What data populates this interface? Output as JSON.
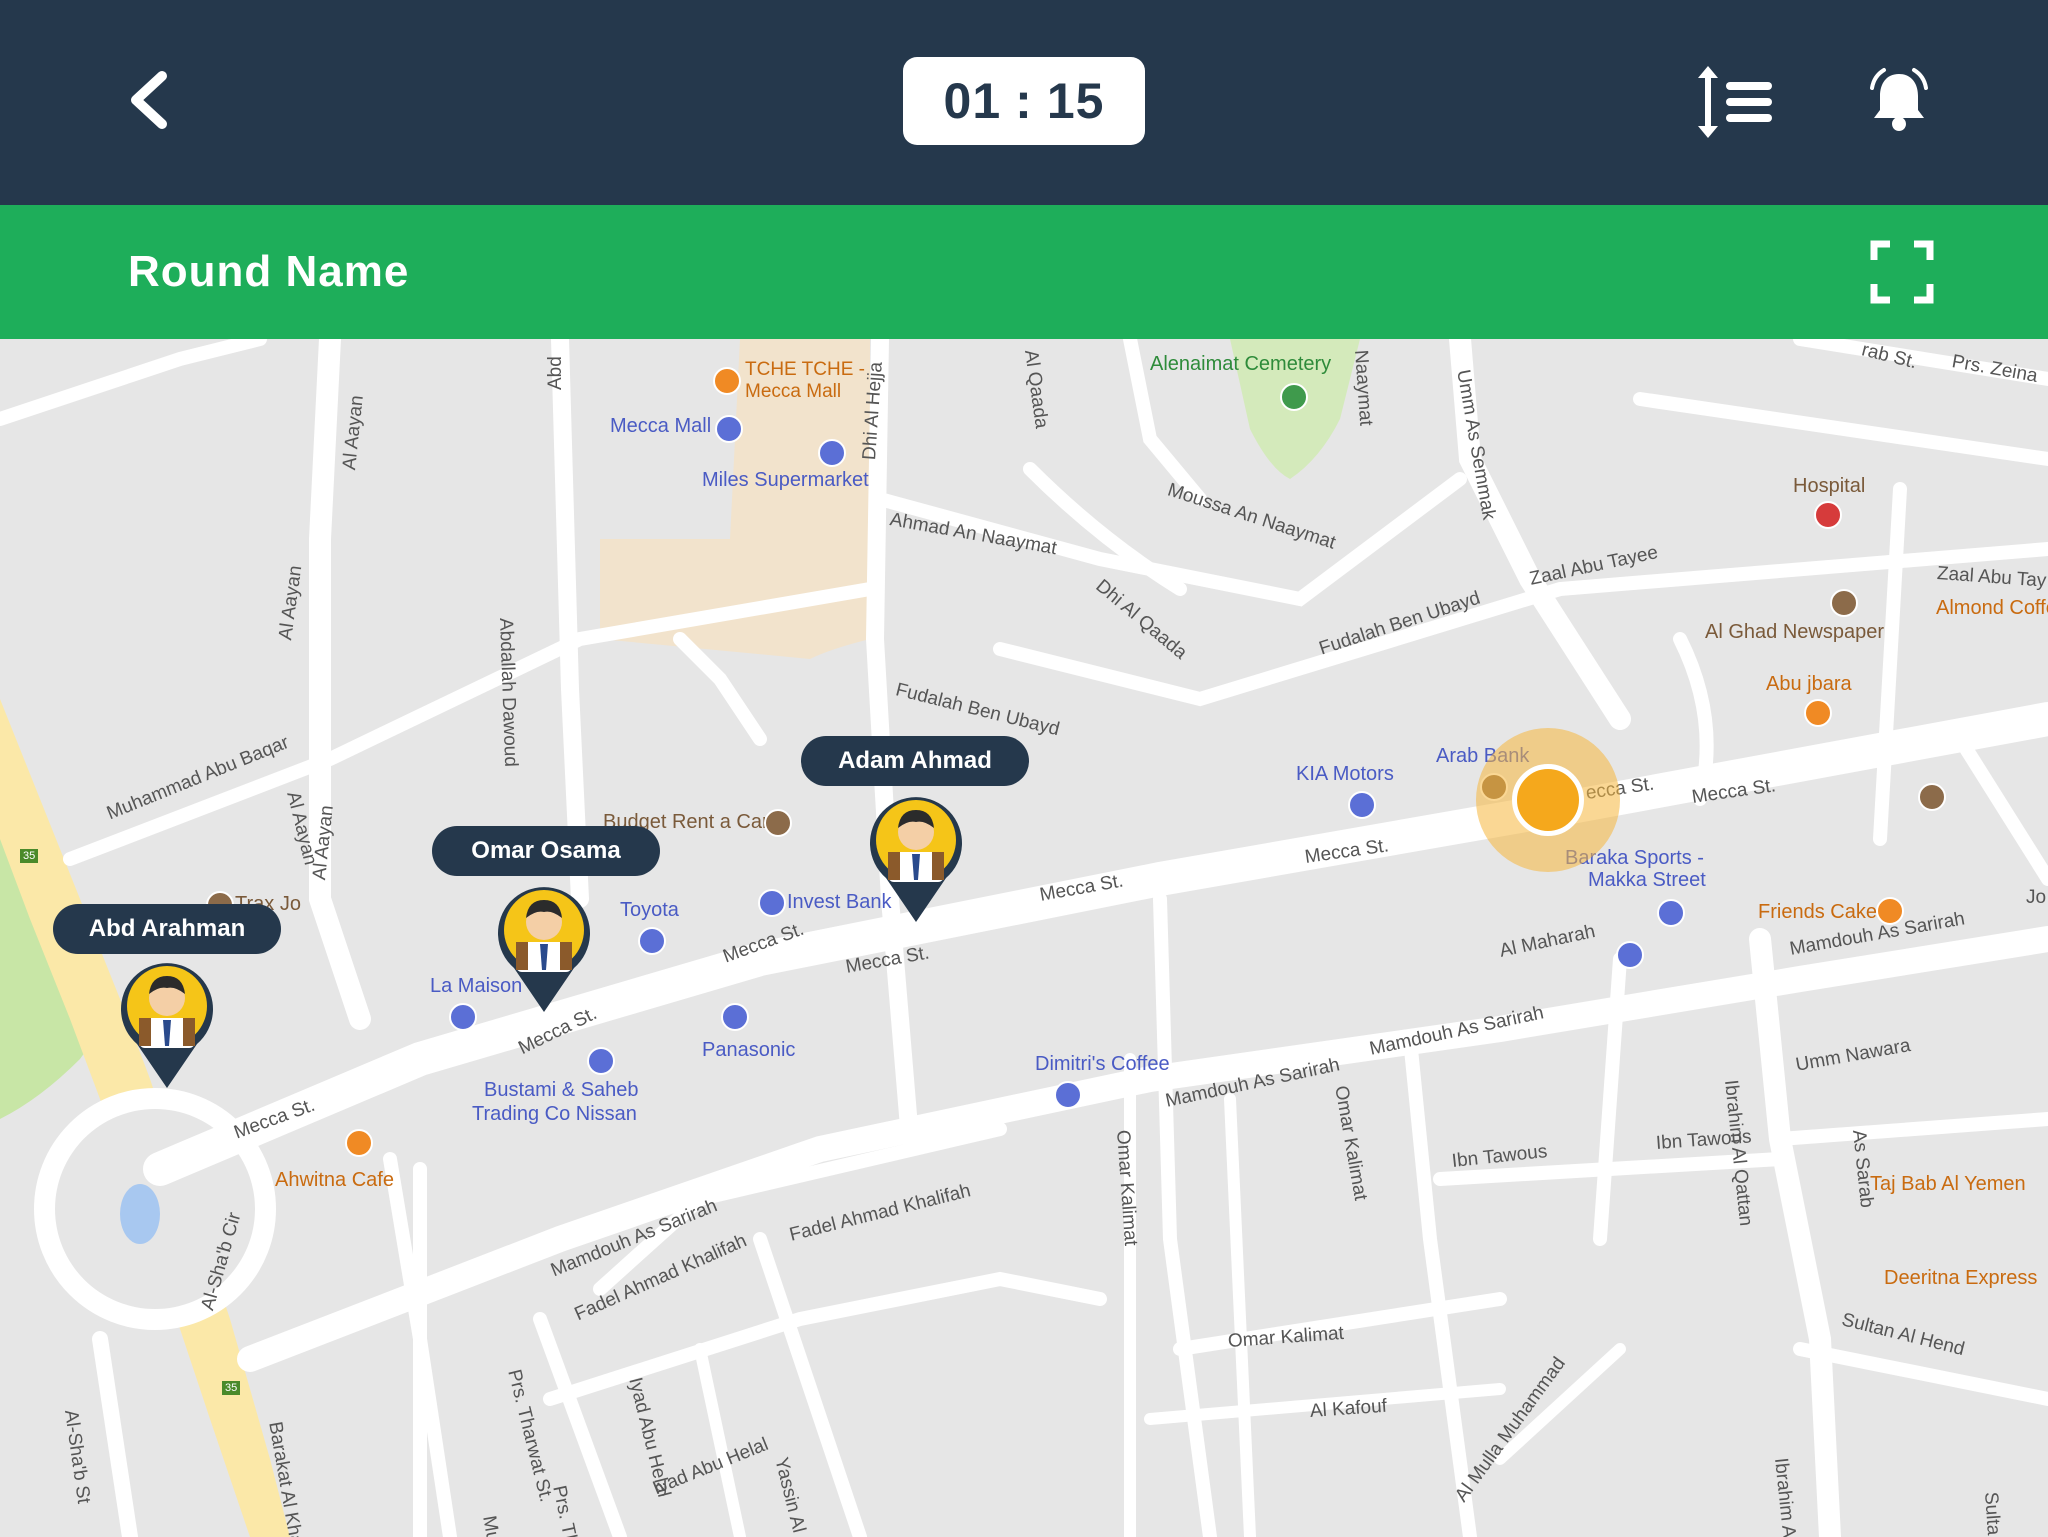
{
  "header": {
    "back_icon": "chevron-left-icon",
    "timer": {
      "minutes": "01",
      "separator": ":",
      "seconds": "15"
    },
    "sort_icon": "sort-list-icon",
    "alarm_icon": "alarm-bell-icon"
  },
  "round": {
    "name": "Round Name",
    "fullscreen_icon": "fullscreen-icon"
  },
  "students": [
    {
      "name": "Adam Ahmad"
    },
    {
      "name": "Omar Osama"
    },
    {
      "name": "Abd Arahman"
    }
  ],
  "map": {
    "pois": [
      "Alenaimat Cemetery",
      "TCHE TCHE -",
      "Mecca Mall",
      "Mecca Mall",
      "Miles Supermarket",
      "Hospital",
      "Al Ghad Newspaper",
      "Almond Coffe",
      "Abu jbara",
      "KIA Motors",
      "Arab Bank",
      "Baraka Sports -",
      "Makka Street",
      "Friends Cake",
      "Budget Rent a Car",
      "Invest Bank",
      "Toyota",
      "La Maison",
      "Panasonic",
      "Bustami & Saheb",
      "Trading Co Nissan",
      "Ahwitna Cafe",
      "Dimitri's Coffee",
      "Taj Bab Al Yemen",
      "Deeritna Express",
      "Trax Jo"
    ],
    "streets": [
      "Al Aayan",
      "Abd",
      "Dhi Al Hejja",
      "Al Qaada",
      "Naaymat",
      "Umm As Semmak",
      "Ahmad An Naaymat",
      "Moussa An Naaymat",
      "Dhi Al Qaada",
      "Zaal Abu Tayee",
      "Zaal Abu Tay",
      "Fudalah Ben Ubayd",
      "Fudalah Ben Ubayd",
      "Abdallah Dawoud",
      "Muhammad Abu Baqar",
      "Al Aayan",
      "Al Aayan",
      "Mecca St.",
      "Mecca St.",
      "Mecca St.",
      "Mecca St.",
      "Mecca St.",
      "Mecca St.",
      "ecca St.",
      "Mecca St.",
      "Al Maharah",
      "Mamdouh As Sarirah",
      "Mamdouh As Sarirah",
      "Mamdouh As Sarirah",
      "Mamdouh As Sarirah",
      "Umm Nawara",
      "As Sarab",
      "Ibrahim Al Qattan",
      "Omar Kalimat",
      "Omar Kalimat",
      "Ibn Tawous",
      "Ibn Tawous",
      "Fadel Ahmad Khalifah",
      "Fadel Ahmad Khalifah",
      "Prs. Tharwat St.",
      "Iyad Abu Helal",
      "Yassin Al Mus",
      "Barakat Al Kharshah",
      "Al-Sha'b Cir",
      "Al-Sha'b St",
      "Omar Kalimat",
      "Al Kafouf",
      "Al Mulla Muhammad",
      "Sultan Al Hend",
      "Ibrahim Al Qa",
      "Prs. Zeina",
      "rab St.",
      "Prs. Tha",
      "Iyad Abu Helal",
      "Mu",
      "Sulta",
      "Jo",
      "Al Aayan"
    ],
    "route_badge": "35"
  }
}
